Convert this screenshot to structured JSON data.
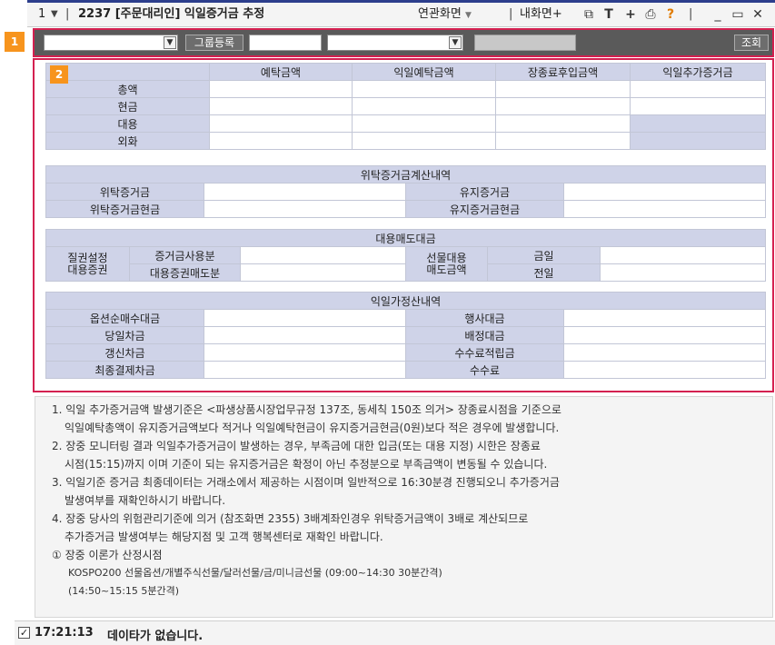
{
  "window": {
    "number": "1",
    "title": "2237 [주문대리인] 익일증거금 추정",
    "menu_link": "연관화면",
    "new_screen": "내화면+",
    "icon_names": [
      "window-icon",
      "text-icon",
      "plus-icon",
      "print-icon",
      "help-icon",
      "minimize-icon",
      "maximize-icon",
      "close-icon"
    ]
  },
  "markers": {
    "section1": "1",
    "section2": "2"
  },
  "toolbar": {
    "group_button": "그룹등록",
    "search_button": "조회"
  },
  "deposit_table": {
    "columns": [
      "예탁금액",
      "익일예탁금액",
      "장종료후입금액",
      "익일추가증거금"
    ],
    "rows": [
      "총액",
      "현금",
      "대용",
      "외화"
    ]
  },
  "margin_section": {
    "header": "위탁증거금계산내역",
    "rows": [
      [
        "위탁증거금",
        "유지증거금"
      ],
      [
        "위탁증거금현금",
        "유지증거금현금"
      ]
    ]
  },
  "substitute_section": {
    "header": "대용매도대금",
    "left_group": "질권설정\n대용증권",
    "left_items": [
      "증거금사용분",
      "대용증권매도분"
    ],
    "mid_group": "선물대용\n매도금액",
    "right_items": [
      "금일",
      "전일"
    ]
  },
  "settlement_section": {
    "header": "익일가정산내역",
    "rows": [
      [
        "옵션순매수대금",
        "행사대금"
      ],
      [
        "당일차금",
        "배정대금"
      ],
      [
        "갱신차금",
        "수수료적립금"
      ],
      [
        "최종결제차금",
        "수수료"
      ]
    ]
  },
  "notes": {
    "n1a": "1. 익일 추가증거금액 발생기준은 <파생상품시장업무규정 137조, 동세칙 150조 의거> 장종료시점을 기준으로",
    "n1b": "익일예탁총액이 유지증거금액보다 적거나 익일예탁현금이 유지증거금현금(0원)보다 적은 경우에 발생합니다.",
    "n2a": "2. 장중 모니터링 결과 익일추가증거금이 발생하는 경우, 부족금에 대한 입금(또는 대용 지정) 시한은  장종료",
    "n2b": "시점(15:15)까지 이며 기준이 되는 유지증거금은 확정이 아닌 추정분으로 부족금액이 변동될 수 있습니다.",
    "n3a": "3. 익일기준 증거금 최종데이터는 거래소에서 제공하는 시점이며 일반적으로 16:30분경 진행되오니 추가증거금",
    "n3b": "발생여부를 재확인하시기 바랍니다.",
    "n4a": "4. 장중 당사의 위험관리기준에 의거 (참조화면 2355) 3배계좌인경우 위탁증거금액이 3배로 계산되므로",
    "n4b": "추가증거금 발생여부는 해당지점 및 고객 행복센터로 재확인 바랍니다.",
    "n5a": "① 장중 이론가 산정시점",
    "n5b": "KOSPO200 선물옵션/개별주식선물/달러선물/금/미니금선물 (09:00~14:30 30분간격)",
    "n5c": "(14:50~15:15 5분간격)"
  },
  "status": {
    "time": "17:21:13",
    "message": "데이타가 없습니다."
  },
  "colors": {
    "header_cell": "#cfd3e8",
    "highlight_border": "#d42050",
    "marker": "#f7941d",
    "toolbar_bg": "#5a5a5a"
  }
}
